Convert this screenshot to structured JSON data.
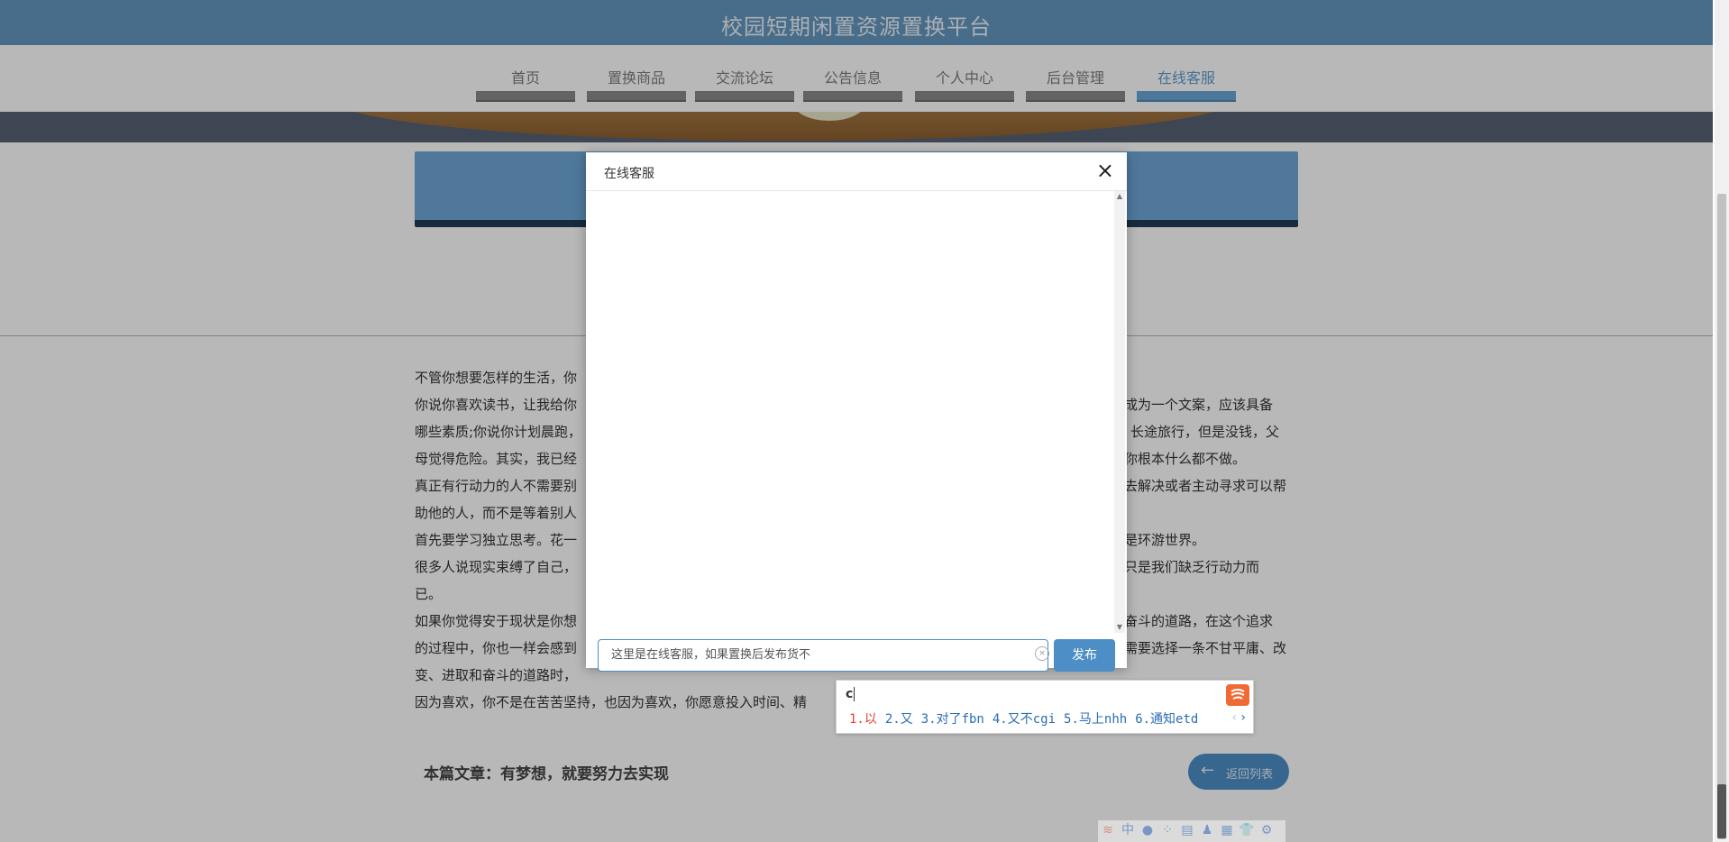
{
  "site": {
    "title": "校园短期闲置资源置换平台"
  },
  "nav": {
    "items": [
      {
        "label": "首页"
      },
      {
        "label": "置换商品"
      },
      {
        "label": "交流论坛"
      },
      {
        "label": "公告信息"
      },
      {
        "label": "个人中心"
      },
      {
        "label": "后台管理"
      },
      {
        "label": "在线客服",
        "active": true
      }
    ]
  },
  "article": {
    "paragraphs": [
      "不管你想要怎样的生活，你",
      "你说你喜欢读书，让我给你",
      "成为一个文案，应该具备",
      "哪些素质;你说你计划晨跑，",
      "长途旅行，但是没钱，父",
      "母觉得危险。其实，我已经",
      "你根本什么都不做。",
      "真正有行动力的人不需要别",
      "去解决或者主动寻求可以帮",
      "助他的人，而不是等着别人",
      "首先要学习独立思考。花一",
      "是环游世界。",
      "很多人说现实束缚了自己，",
      "只是我们缺乏行动力而",
      "已。",
      "如果你觉得安于现状是你想",
      "奋斗的道路，在这个追求",
      "的过程中，你也一样会感到",
      "需要选择一条不甘平庸、改",
      "变、进取和奋斗的道路时，",
      "因为喜欢，你不是在苦苦坚持，也因为喜欢，你愿意投入时间、精"
    ],
    "footer_label": "本篇文章：有梦想，就要努力去实现",
    "back_button": "返回列表"
  },
  "modal": {
    "title": "在线客服",
    "close_glyph": "×",
    "input_value": "这里是在线客服，如果置换后发布货不",
    "publish_button": "发布"
  },
  "ime": {
    "composition": "c",
    "candidates": [
      "1.以",
      "2.又",
      "3.对了fbn",
      "4.又不cgi",
      "5.马上nhh",
      "6.通知etd"
    ],
    "toolbar": [
      "中",
      "●",
      "⁘",
      "▤",
      "♟",
      "▦",
      "👕",
      "⚙"
    ]
  },
  "colors": {
    "header": "#6497bf",
    "accent": "#4d8ec6",
    "ime_first": "#e2422e"
  }
}
